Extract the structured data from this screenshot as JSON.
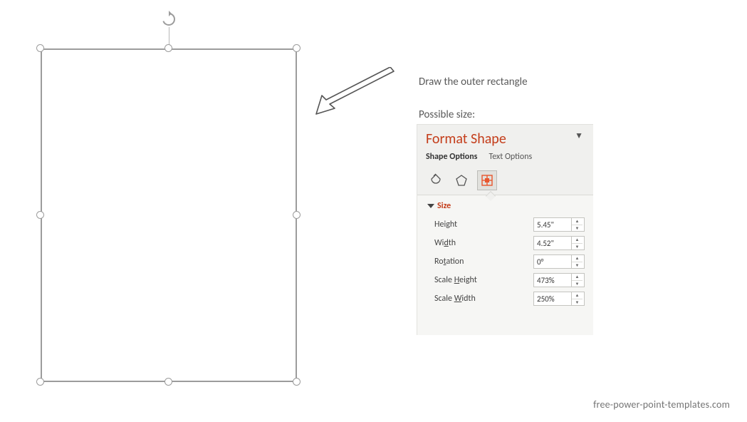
{
  "annotations": {
    "instruction1": "Draw the outer rectangle",
    "instruction2": "Possible size:"
  },
  "panel": {
    "title": "Format Shape",
    "tabs": {
      "shape_options": "Shape Options",
      "text_options": "Text Options"
    },
    "section_size_label": "Size",
    "props": {
      "height_label_prefix": "H",
      "height_label_rest": "eight",
      "height_value": "5.45\"",
      "width_label_prefix": "Wi",
      "width_label_u": "d",
      "width_label_rest": "th",
      "width_value": "4.52\"",
      "rotation_label_prefix": "Ro",
      "rotation_label_u": "t",
      "rotation_label_rest": "ation",
      "rotation_value": "0°",
      "scale_h_prefix": "Scale ",
      "scale_h_u": "H",
      "scale_h_rest": "eight",
      "scale_h_value": "473%",
      "scale_w_prefix": "Scale ",
      "scale_w_u": "W",
      "scale_w_rest": "idth",
      "scale_w_value": "250%"
    }
  },
  "watermark": "free-power-point-templates.com"
}
